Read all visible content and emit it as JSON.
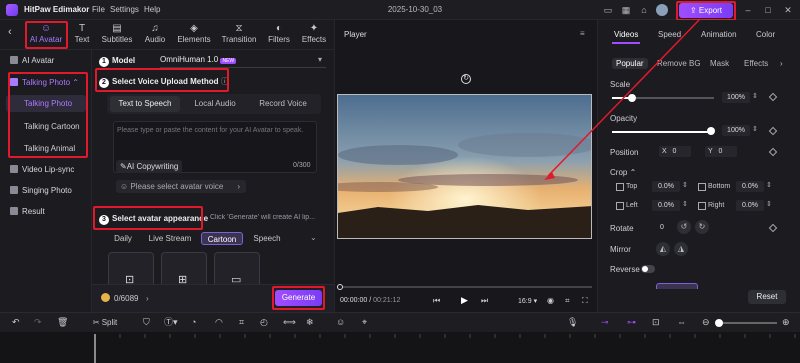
{
  "app": {
    "name": "HitPaw Edimakor",
    "project": "2025-10-30_03"
  },
  "menu": [
    "File",
    "Settings",
    "Help"
  ],
  "export_label": "Export",
  "tools": [
    {
      "label": "AI Avatar",
      "icon": "avatar-icon"
    },
    {
      "label": "Text",
      "icon": "text-icon"
    },
    {
      "label": "Subtitles",
      "icon": "subtitles-icon"
    },
    {
      "label": "Audio",
      "icon": "music-icon"
    },
    {
      "label": "Elements",
      "icon": "elements-icon"
    },
    {
      "label": "Transition",
      "icon": "transition-icon"
    },
    {
      "label": "Filters",
      "icon": "filters-icon"
    },
    {
      "label": "Effects",
      "icon": "effects-icon"
    }
  ],
  "sidebar": {
    "items": [
      "AI Avatar",
      "Talking Photo",
      "Video Lip-sync",
      "Singing Photo",
      "Result"
    ],
    "sub_items": [
      "Talking Photo",
      "Talking Cartoon",
      "Talking Animal"
    ]
  },
  "model": {
    "num": "1",
    "label": "Model",
    "value": "OmniHuman 1.0",
    "badge": "NEW"
  },
  "voice": {
    "num": "2",
    "title": "Select Voice Upload Method",
    "tabs": [
      "Text to Speech",
      "Local Audio",
      "Record Voice"
    ],
    "placeholder": "Please type or paste the content for your AI Avatar to speak.",
    "copywriting": "AI Copywriting",
    "counter": "0/300",
    "select_voice": "Please select avatar voice"
  },
  "appearance": {
    "num": "3",
    "title": "Select avatar appearance",
    "hint": "Click 'Generate' will create AI lip...",
    "tabs": [
      "Daily",
      "Live Stream",
      "Cartoon",
      "Speech"
    ]
  },
  "credits": "0/6089",
  "generate_label": "Generate",
  "player": {
    "title": "Player",
    "time": "00:00:00",
    "duration": "00:21:12",
    "ratio": "16:9"
  },
  "right": {
    "tabs": [
      "Videos",
      "Speed",
      "Animation",
      "Color"
    ],
    "subtabs": [
      "Popular",
      "Remove BG",
      "Mask",
      "Effects"
    ],
    "scale_label": "Scale",
    "scale_value": "100%",
    "opacity_label": "Opacity",
    "opacity_value": "100%",
    "position_label": "Position",
    "pos_x_label": "X",
    "pos_x": "0",
    "pos_y_label": "Y",
    "pos_y": "0",
    "crop_label": "Crop",
    "crop_top_label": "Top",
    "crop_top": "0.0%",
    "crop_bottom_label": "Bottom",
    "crop_bottom": "0.0%",
    "crop_left_label": "Left",
    "crop_left": "0.0%",
    "crop_right_label": "Right",
    "crop_right": "0.0%",
    "rotate_label": "Rotate",
    "rotate_value": "0",
    "mirror_label": "Mirror",
    "reverse_label": "Reverse",
    "reset_label": "Reset"
  },
  "timeline_split": "Split",
  "colors": {
    "accent": "#a04dff",
    "highlight": "#e0192b"
  }
}
